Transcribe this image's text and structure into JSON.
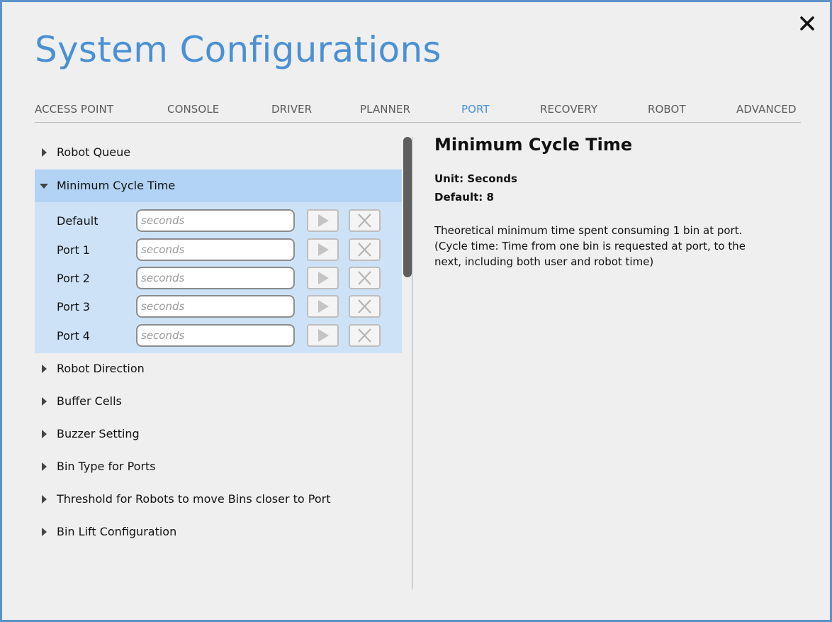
{
  "dialog": {
    "title": "System Configurations",
    "close_icon": "close-icon"
  },
  "tabs": [
    {
      "label": "ACCESS POINT",
      "active": false
    },
    {
      "label": "CONSOLE",
      "active": false
    },
    {
      "label": "DRIVER",
      "active": false
    },
    {
      "label": "PLANNER",
      "active": false
    },
    {
      "label": "PORT",
      "active": true
    },
    {
      "label": "RECOVERY",
      "active": false
    },
    {
      "label": "ROBOT",
      "active": false
    },
    {
      "label": "ADVANCED",
      "active": false
    }
  ],
  "sections": [
    {
      "label": "Robot Queue",
      "expanded": false
    },
    {
      "label": "Minimum Cycle Time",
      "expanded": true
    },
    {
      "label": "Robot Direction",
      "expanded": false
    },
    {
      "label": "Buffer Cells",
      "expanded": false
    },
    {
      "label": "Buzzer Setting",
      "expanded": false
    },
    {
      "label": "Bin Type for Ports",
      "expanded": false
    },
    {
      "label": "Threshold for Robots to move Bins closer to Port",
      "expanded": false
    },
    {
      "label": "Bin Lift Configuration",
      "expanded": false
    }
  ],
  "cycle_time_rows": [
    {
      "label": "Default",
      "value": "",
      "placeholder": "seconds"
    },
    {
      "label": "Port 1",
      "value": "",
      "placeholder": "seconds"
    },
    {
      "label": "Port 2",
      "value": "",
      "placeholder": "seconds"
    },
    {
      "label": "Port 3",
      "value": "",
      "placeholder": "seconds"
    },
    {
      "label": "Port 4",
      "value": "",
      "placeholder": "seconds"
    }
  ],
  "detail": {
    "title": "Minimum Cycle Time",
    "unit": "Unit: Seconds",
    "default": "Default: 8",
    "description_line1": "Theoretical minimum time spent consuming 1 bin at port.",
    "description_line2": "(Cycle time: Time from one bin is requested at port, to the",
    "description_line3": "next, including both user and robot time)"
  },
  "colors": {
    "accent": "#4a90d4",
    "selected_row": "#b2d3f3",
    "expanded_body": "#cde2f7",
    "dialog_bg": "#efefef",
    "border": "#5b92c8"
  },
  "icons": {
    "expand_collapsed": "caret-right-icon",
    "expand_open": "caret-down-icon",
    "apply": "play-icon",
    "clear": "clear-x-icon"
  }
}
